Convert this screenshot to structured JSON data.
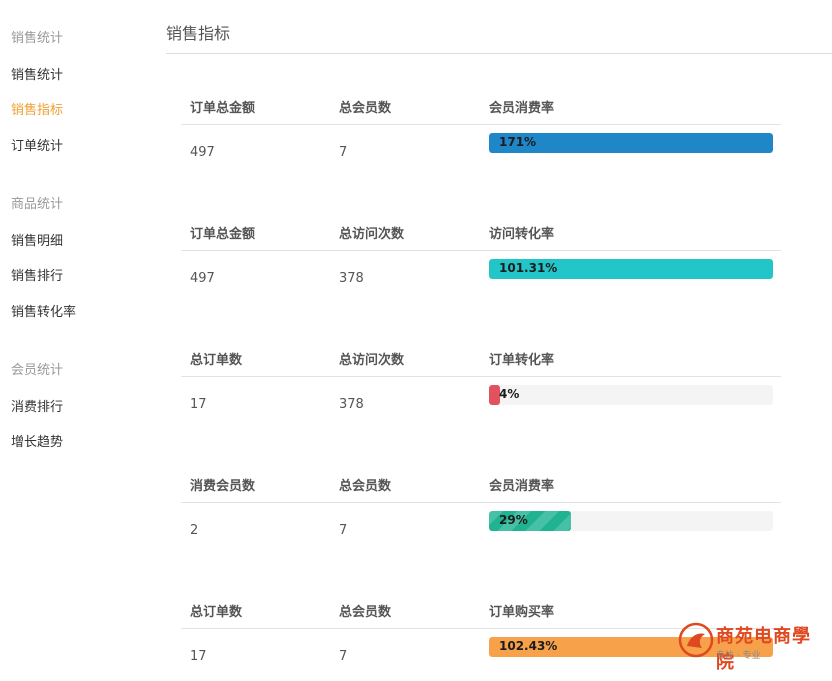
{
  "sidebar": {
    "groups": [
      {
        "label": "销售统计",
        "items": [
          "销售统计",
          "销售指标",
          "订单统计"
        ]
      },
      {
        "label": "商品统计",
        "items": [
          "销售明细",
          "销售排行",
          "销售转化率"
        ]
      },
      {
        "label": "会员统计",
        "items": [
          "消费排行",
          "增长趋势"
        ]
      }
    ],
    "active": "销售指标"
  },
  "main": {
    "title": "销售指标",
    "cards": [
      {
        "h1": "订单总金额",
        "h2": "总会员数",
        "h3": "会员消费率",
        "v1": "497",
        "v2": "7",
        "rate_text": "171%",
        "rate_pct": 171,
        "color": "#1f86c8"
      },
      {
        "h1": "订单总金额",
        "h2": "总访问次数",
        "h3": "访问转化率",
        "v1": "497",
        "v2": "378",
        "rate_text": "101.31%",
        "rate_pct": 101.31,
        "color": "#23c6c8"
      },
      {
        "h1": "总订单数",
        "h2": "总访问次数",
        "h3": "订单转化率",
        "v1": "17",
        "v2": "378",
        "rate_text": "4%",
        "rate_pct": 4,
        "color": "#e2525e"
      },
      {
        "h1": "消费会员数",
        "h2": "总会员数",
        "h3": "会员消费率",
        "v1": "2",
        "v2": "7",
        "rate_text": "29%",
        "rate_pct": 29,
        "color": "#1fb391",
        "striped": true
      },
      {
        "h1": "总订单数",
        "h2": "总会员数",
        "h3": "订单购买率",
        "v1": "17",
        "v2": "7",
        "rate_text": "102.43%",
        "rate_pct": 102.43,
        "color": "#f7a24b"
      }
    ]
  },
  "watermark": {
    "text": "商苑电商學院",
    "sub": "专注 · 专业"
  }
}
